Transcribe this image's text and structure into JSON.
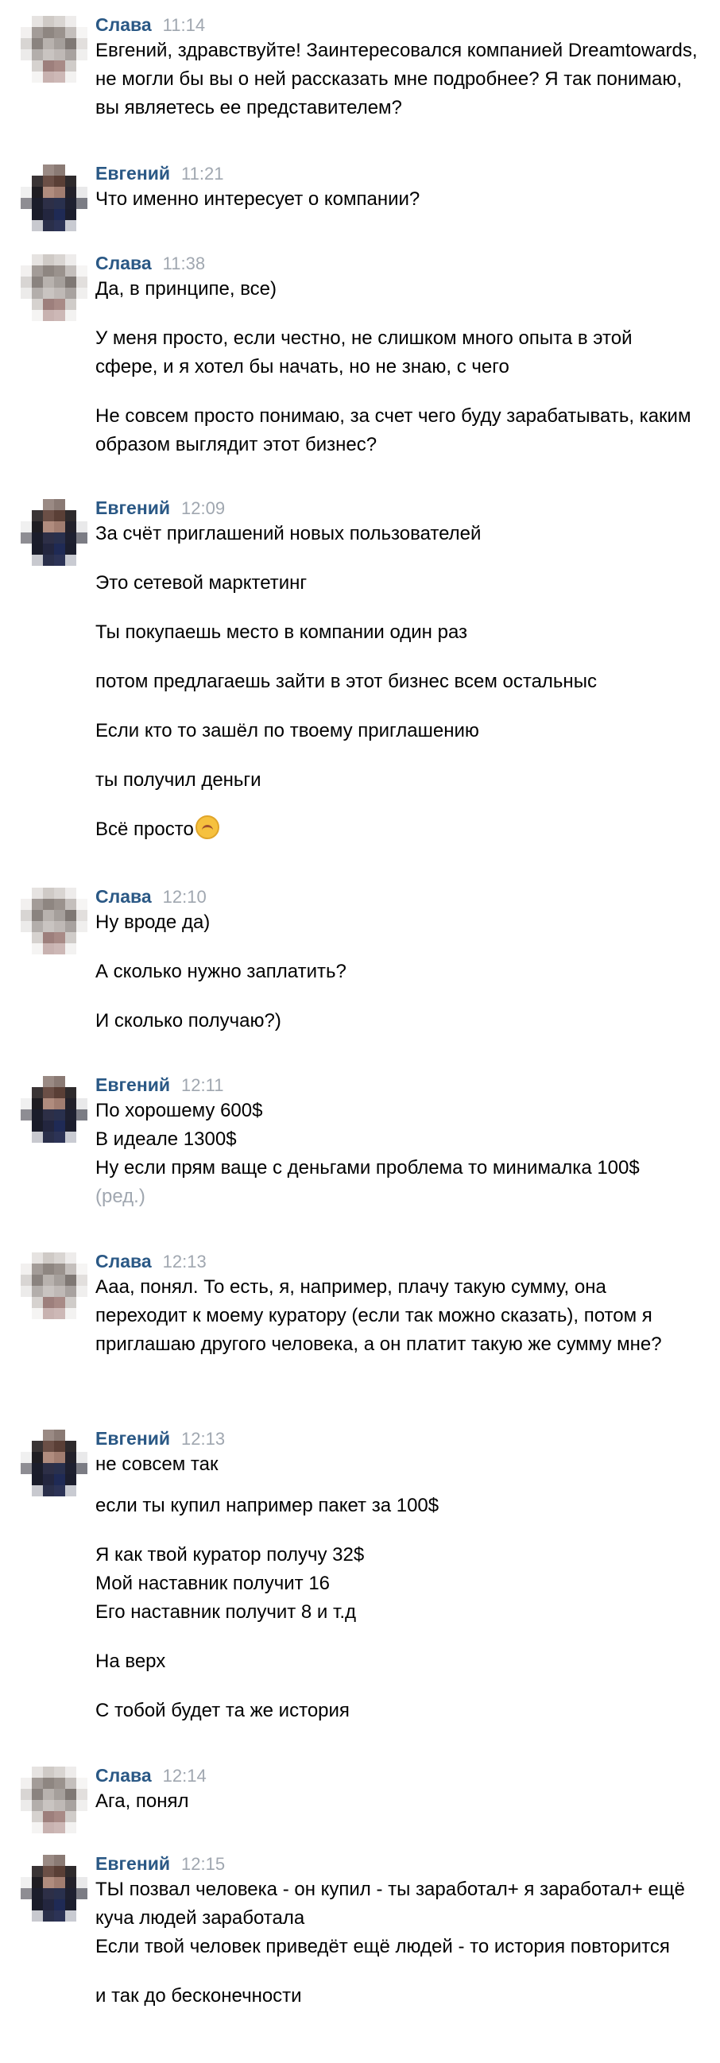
{
  "colors": {
    "name": "#2a5885",
    "time": "#a0a7b0",
    "text": "#000000",
    "background": "#ffffff"
  },
  "messages": [
    {
      "sender": "Слава",
      "time": "11:14",
      "avatar": "slava",
      "paragraphs": [
        "Евгений, здравствуйте! Заинтересовался компанией Dreamtowards, не могли бы вы о ней рассказать мне подробнее? Я так понимаю, вы являетесь ее представителем?"
      ]
    },
    {
      "sender": "Евгений",
      "time": "11:21",
      "avatar": "evgeniy",
      "paragraphs": [
        "Что именно интересует о компании?"
      ]
    },
    {
      "sender": "Слава",
      "time": "11:38",
      "avatar": "slava",
      "paragraphs": [
        "Да, в принципе, все)",
        "У меня просто, если честно, не слишком много опыта в этой сфере, и я хотел бы начать, но не знаю, с чего",
        "Не совсем просто понимаю, за счет чего буду зарабатывать, каким образом выглядит этот бизнес?"
      ]
    },
    {
      "sender": "Евгений",
      "time": "12:09",
      "avatar": "evgeniy",
      "paragraphs": [
        "За счёт приглашений новых пользователей",
        "Это сетевой марктетинг",
        "Ты покупаешь место в компании один раз",
        "потом предлагаешь зайти в этот бизнес всем остальныс",
        "Если кто то зашёл по твоему приглашению",
        "ты получил деньги",
        "Всё просто"
      ],
      "emoji": "upside-down-face"
    },
    {
      "sender": "Слава",
      "time": "12:10",
      "avatar": "slava",
      "paragraphs": [
        "Ну вроде да)",
        "А сколько нужно заплатить?",
        "И сколько получаю?)"
      ]
    },
    {
      "sender": "Евгений",
      "time": "12:11",
      "avatar": "evgeniy",
      "paragraphs": [
        "По хорошему 600$\nВ идеале 1300$\nНу если прям ваще с деньгами проблема то минималка 100$"
      ],
      "edited": "(ред.)"
    },
    {
      "sender": "Слава",
      "time": "12:13",
      "avatar": "slava",
      "paragraphs": [
        "Ааа, понял. То есть, я, например, плачу такую сумму, она переходит к моему куратору (если так можно сказать), потом я приглашаю другого человека, а он платит такую же сумму мне?"
      ]
    },
    {
      "sender": "Евгений",
      "time": "12:13",
      "avatar": "evgeniy",
      "paragraphs": [
        "не совсем так",
        "если ты купил например пакет за 100$",
        "Я как твой куратор получу 32$\nМой наставник получит 16\nЕго наставник получит 8 и т.д",
        "На верх",
        "С тобой будет та же история"
      ]
    },
    {
      "sender": "Слава",
      "time": "12:14",
      "avatar": "slava",
      "paragraphs": [
        "Ага, понял"
      ]
    },
    {
      "sender": "Евгений",
      "time": "12:15",
      "avatar": "evgeniy",
      "paragraphs": [
        "ТЫ позвал человека - он купил - ты заработал+ я заработал+ ещё куча людей заработала\nЕсли твой человек приведёт ещё людей - то история повторится",
        "и так до бесконечности"
      ]
    }
  ]
}
